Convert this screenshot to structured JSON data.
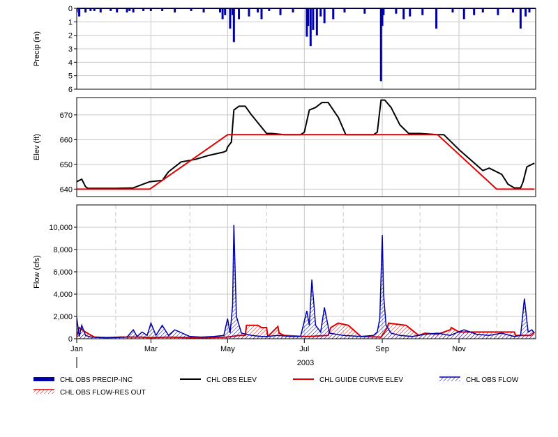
{
  "chart_data": [
    {
      "type": "bar",
      "ylabel": "Precip (in)",
      "ylim": [
        0,
        6
      ],
      "y_inverted": true,
      "yticks": [
        "0",
        "1",
        "2",
        "3",
        "4",
        "5",
        "6"
      ],
      "color": "#0000a8",
      "series": [
        {
          "name": "CHL OBS PRECIP-INC",
          "x": [
            "Jan 1",
            "Jan 3",
            "Jan 8",
            "Jan 12",
            "Jan 15",
            "Jan 20",
            "Jan 28",
            "Feb 2",
            "Feb 10",
            "Feb 12",
            "Feb 15",
            "Feb 23",
            "Mar 1",
            "Mar 10",
            "Mar 20",
            "Apr 2",
            "Apr 12",
            "Apr 25",
            "Apr 27",
            "Apr 29",
            "May 3",
            "May 5",
            "May 6",
            "May 10",
            "May 18",
            "May 25",
            "May 28",
            "Jun 3",
            "Jun 12",
            "Jun 22",
            "Jul 3",
            "Jul 4",
            "Jul 6",
            "Jul 8",
            "Jul 11",
            "Jul 14",
            "Jul 17",
            "Jul 24",
            "Aug 2",
            "Aug 18",
            "Aug 31",
            "Sep 1",
            "Sep 2",
            "Sep 12",
            "Sep 18",
            "Sep 23",
            "Oct 3",
            "Oct 14",
            "Oct 27",
            "Nov 5",
            "Nov 13",
            "Nov 20",
            "Dec 2",
            "Dec 14",
            "Dec 20",
            "Dec 24",
            "Dec 27"
          ],
          "values": [
            0.3,
            0.6,
            0.3,
            0.2,
            0.2,
            0.3,
            0.2,
            0.3,
            0.3,
            0.2,
            0.3,
            0.2,
            0.2,
            0.2,
            0.3,
            0.2,
            0.3,
            0.3,
            0.8,
            0.5,
            1.5,
            0.5,
            2.5,
            0.8,
            0.6,
            0.3,
            0.8,
            0.2,
            0.5,
            0.3,
            2.1,
            1.3,
            2.8,
            1.6,
            2.0,
            0.6,
            1.1,
            0.8,
            0.3,
            0.4,
            5.4,
            1.3,
            0.5,
            0.4,
            0.8,
            0.6,
            0.5,
            1.5,
            0.3,
            0.8,
            0.5,
            0.3,
            0.5,
            0.3,
            1.5,
            0.6,
            0.3
          ]
        }
      ]
    },
    {
      "type": "line",
      "ylabel": "Elev (ft)",
      "ylim": [
        637,
        677
      ],
      "yticks": [
        "640",
        "650",
        "660",
        "670"
      ],
      "series": [
        {
          "name": "CHL OBS ELEV",
          "color": "#000000",
          "x": [
            "Jan 1",
            "Jan 5",
            "Jan 8",
            "Jan 10",
            "Jan 15",
            "Feb 1",
            "Feb 15",
            "Feb 28",
            "Mar 10",
            "Mar 15",
            "Mar 25",
            "Apr 5",
            "Apr 15",
            "Apr 28",
            "Apr 30",
            "May 1",
            "May 4",
            "May 6",
            "May 10",
            "May 15",
            "May 20",
            "May 28",
            "Jun 1",
            "Jun 5",
            "Jun 15",
            "Jun 28",
            "Jul 1",
            "Jul 5",
            "Jul 10",
            "Jul 15",
            "Jul 20",
            "Jul 28",
            "Aug 3",
            "Aug 15",
            "Aug 25",
            "Aug 28",
            "Aug 31",
            "Sep 3",
            "Sep 8",
            "Sep 15",
            "Sep 22",
            "Oct 1",
            "Oct 15",
            "Oct 20",
            "Nov 1",
            "Nov 20",
            "Nov 25",
            "Dec 5",
            "Dec 10",
            "Dec 15",
            "Dec 20",
            "Dec 22",
            "Dec 25",
            "Dec 31"
          ],
          "values": [
            643,
            644,
            641,
            640.3,
            640.3,
            640.3,
            640.5,
            643,
            643.5,
            647,
            651,
            652,
            653.5,
            655,
            655.5,
            657,
            659,
            672,
            673.5,
            673.5,
            670,
            665,
            662.5,
            662.5,
            662,
            662,
            663,
            672,
            673,
            675,
            675,
            669,
            662,
            662,
            662,
            663,
            676,
            676,
            673,
            666,
            662.5,
            662.5,
            662,
            662,
            656,
            647.5,
            648.5,
            646,
            642,
            640.5,
            640.5,
            643,
            649,
            650.5
          ]
        },
        {
          "name": "CHL GUIDE CURVE ELEV",
          "color": "#e00000",
          "x": [
            "Jan 1",
            "Feb 28",
            "May 1",
            "Oct 15",
            "Dec 1",
            "Dec 31"
          ],
          "values": [
            640,
            640,
            662,
            662,
            640,
            640
          ]
        }
      ]
    },
    {
      "type": "area",
      "ylabel": "Flow (cfs)",
      "ylim": [
        0,
        12000
      ],
      "yticks": [
        "0",
        "2,000",
        "4,000",
        "6,000",
        "8,000",
        "10,000"
      ],
      "series": [
        {
          "name": "CHL OBS FLOW",
          "color": "#0000a8",
          "x": [
            "Jan 1",
            "Jan 3",
            "Jan 5",
            "Jan 8",
            "Jan 12",
            "Jan 20",
            "Feb 1",
            "Feb 10",
            "Feb 15",
            "Feb 18",
            "Feb 22",
            "Feb 26",
            "Mar 1",
            "Mar 5",
            "Mar 10",
            "Mar 15",
            "Mar 20",
            "Apr 1",
            "Apr 10",
            "Apr 20",
            "Apr 28",
            "May 1",
            "May 3",
            "May 5",
            "May 6",
            "May 8",
            "May 12",
            "May 20",
            "May 28",
            "Jun 1",
            "Jun 10",
            "Jun 20",
            "Jun 28",
            "Jul 3",
            "Jul 5",
            "Jul 7",
            "Jul 10",
            "Jul 14",
            "Jul 17",
            "Jul 21",
            "Aug 1",
            "Aug 15",
            "Aug 25",
            "Aug 28",
            "Aug 30",
            "Sep 1",
            "Sep 2",
            "Sep 4",
            "Sep 8",
            "Sep 15",
            "Sep 25",
            "Oct 5",
            "Oct 15",
            "Oct 25",
            "Nov 5",
            "Nov 15",
            "Nov 25",
            "Dec 5",
            "Dec 15",
            "Dec 20",
            "Dec 23",
            "Dec 26",
            "Dec 29",
            "Dec 31"
          ],
          "values": [
            1900,
            200,
            1200,
            300,
            150,
            100,
            100,
            150,
            800,
            200,
            600,
            300,
            1400,
            300,
            1200,
            300,
            800,
            200,
            150,
            200,
            300,
            1800,
            500,
            3000,
            10200,
            2000,
            500,
            300,
            200,
            200,
            300,
            200,
            200,
            2500,
            1200,
            5300,
            1200,
            600,
            2800,
            500,
            300,
            200,
            300,
            600,
            1800,
            9300,
            4000,
            1200,
            500,
            300,
            200,
            400,
            500,
            300,
            800,
            400,
            300,
            500,
            200,
            300,
            3600,
            600,
            800,
            500
          ]
        },
        {
          "name": "CHL OBS FLOW-RES OUT",
          "color": "#e00000",
          "x": [
            "Jan 1",
            "Jan 3",
            "Jan 8",
            "Jan 15",
            "Jan 25",
            "Feb 5",
            "Feb 20",
            "Mar 1",
            "Mar 15",
            "Apr 1",
            "Apr 15",
            "May 1",
            "May 10",
            "May 15",
            "May 16",
            "May 25",
            "May 28",
            "Jun 1",
            "Jun 2",
            "Jun 10",
            "Jun 11",
            "Jun 15",
            "Jun 30",
            "Jul 5",
            "Jul 20",
            "Jul 22",
            "Jul 28",
            "Aug 5",
            "Aug 15",
            "Aug 31",
            "Sep 5",
            "Sep 6",
            "Sep 20",
            "Sep 30",
            "Oct 5",
            "Oct 15",
            "Oct 25",
            "Oct 26",
            "Nov 1",
            "Nov 15",
            "Dec 1",
            "Dec 15",
            "Dec 16",
            "Dec 28",
            "Dec 31"
          ],
          "values": [
            200,
            1000,
            600,
            150,
            100,
            150,
            150,
            100,
            150,
            100,
            100,
            150,
            300,
            300,
            1200,
            1200,
            1000,
            1000,
            200,
            1100,
            500,
            300,
            200,
            200,
            300,
            1000,
            1400,
            1200,
            200,
            150,
            1000,
            1400,
            1200,
            300,
            500,
            400,
            800,
            1000,
            600,
            600,
            600,
            600,
            300,
            300,
            600
          ]
        }
      ]
    }
  ],
  "x_axis": {
    "ticks": [
      "Jan",
      "Mar",
      "May",
      "Jul",
      "Sep",
      "Nov"
    ],
    "year": "2003"
  },
  "legend": [
    {
      "label": "CHL OBS PRECIP-INC",
      "style": "thick",
      "color": "#0000a8"
    },
    {
      "label": "CHL OBS ELEV",
      "style": "line",
      "color": "#000000"
    },
    {
      "label": "CHL GUIDE CURVE ELEV",
      "style": "line",
      "color": "#e00000"
    },
    {
      "label": "CHL OBS FLOW",
      "style": "hatch",
      "color": "#0000a8"
    },
    {
      "label": "CHL OBS FLOW-RES OUT",
      "style": "hatch",
      "color": "#e00000"
    }
  ]
}
